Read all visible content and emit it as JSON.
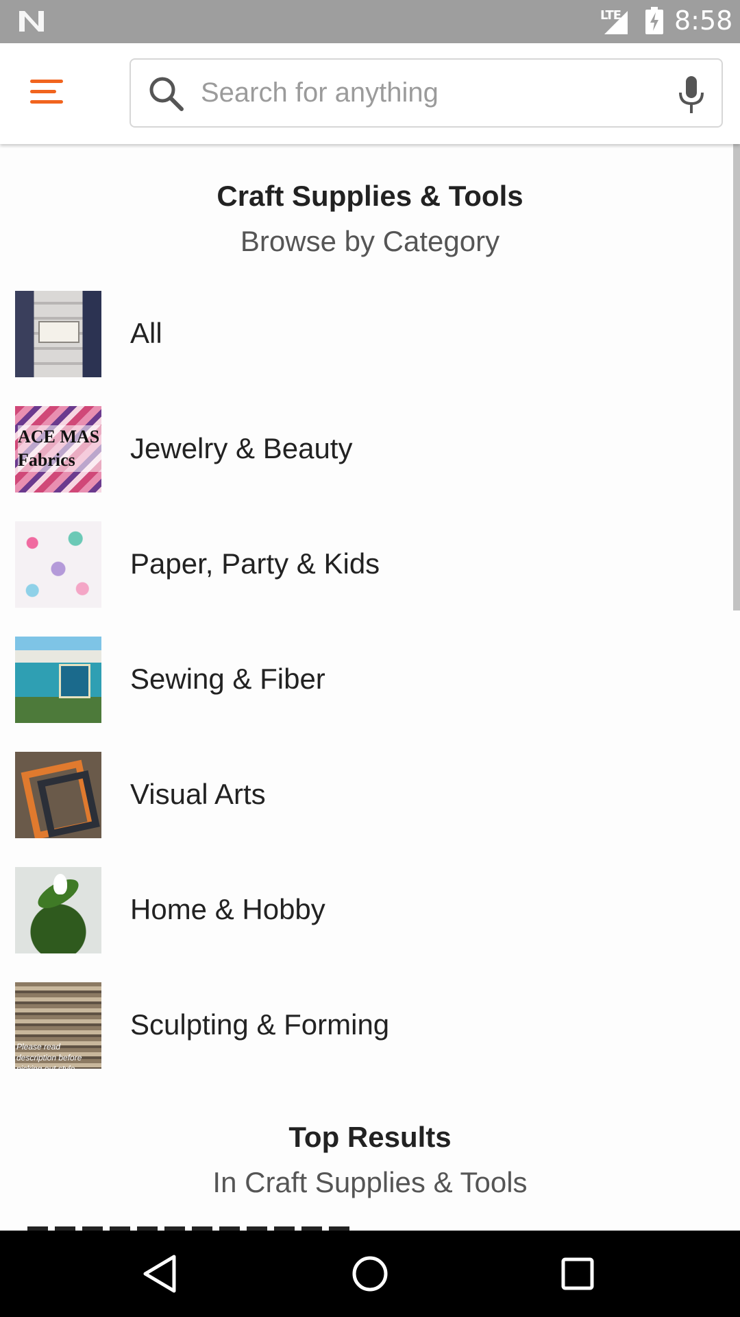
{
  "status_bar": {
    "network_label": "LTE",
    "time": "8:58"
  },
  "search": {
    "placeholder": "Search for anything",
    "value": ""
  },
  "icons": {
    "menu": "hamburger-menu-icon",
    "search": "search-icon",
    "mic": "microphone-icon",
    "back": "back-triangle-icon",
    "home": "home-circle-icon",
    "recents": "recents-square-icon"
  },
  "colors": {
    "accent": "#f1641e",
    "status_bar_bg": "#9e9e9e",
    "nav_bar_bg": "#000000"
  },
  "header": {
    "title": "Craft Supplies & Tools",
    "subtitle": "Browse by Category"
  },
  "categories": [
    {
      "label": "All"
    },
    {
      "label": "Jewelry & Beauty",
      "thumb_text": "ACE MAS Fabrics"
    },
    {
      "label": "Paper, Party & Kids"
    },
    {
      "label": "Sewing & Fiber"
    },
    {
      "label": "Visual Arts"
    },
    {
      "label": "Home & Hobby"
    },
    {
      "label": "Sculpting & Forming",
      "thumb_text": "Please read description before picking out style"
    }
  ],
  "top_results": {
    "title": "Top Results",
    "subtitle": "In Craft Supplies & Tools"
  }
}
